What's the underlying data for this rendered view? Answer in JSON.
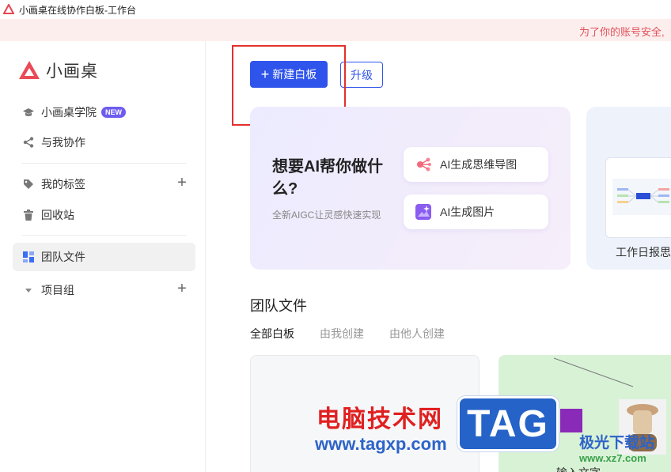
{
  "window": {
    "title": "小画桌在线协作白板-工作台"
  },
  "banner": {
    "text": "为了你的账号安全,"
  },
  "sidebar": {
    "logo_text": "小画桌",
    "items": [
      {
        "label": "小画桌学院",
        "badge": "NEW"
      },
      {
        "label": "与我协作"
      },
      {
        "label": "我的标签"
      },
      {
        "label": "回收站"
      },
      {
        "label": "团队文件"
      },
      {
        "label": "项目组"
      }
    ]
  },
  "toolbar": {
    "new_board_label": "新建白板",
    "upgrade_label": "升级"
  },
  "ai_card": {
    "title": "想要AI帮你做什么?",
    "subtitle": "全新AIGC让灵感快速实现",
    "actions": [
      {
        "label": "AI生成思维导图"
      },
      {
        "label": "AI生成图片"
      }
    ]
  },
  "template_card": {
    "label": "工作日报思"
  },
  "team_files": {
    "title": "团队文件",
    "tabs": [
      {
        "label": "全部白板"
      },
      {
        "label": "由我创建"
      },
      {
        "label": "由他人创建"
      }
    ],
    "card_label": "输入文字"
  },
  "watermark": {
    "line1": "电脑技术网",
    "line2": "www.tagxp.com",
    "tag": "TAG",
    "site_name": "极光下载站",
    "site_url": "www.xz7.com"
  },
  "colors": {
    "primary": "#2f54eb",
    "highlight_box": "#e2302b",
    "new_badge": "#6d5cf0",
    "banner_text": "#e0525a"
  }
}
